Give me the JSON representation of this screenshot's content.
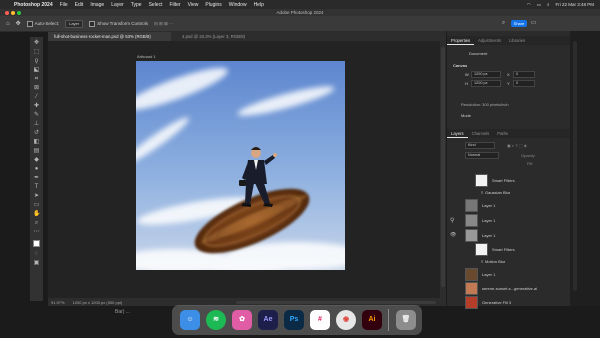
{
  "menubar": {
    "apple": "",
    "items": [
      "Photoshop 2024",
      "File",
      "Edit",
      "Image",
      "Layer",
      "Type",
      "Select",
      "Filter",
      "View",
      "Plugins",
      "Window",
      "Help"
    ],
    "clock": "Fri 22 Mar  3:48 PM"
  },
  "window": {
    "title": "Adobe Photoshop 2024"
  },
  "options": {
    "auto_select": "Auto-Select:",
    "layer_value": "Layer",
    "show_transform": "Show Transform Controls",
    "share": "Share"
  },
  "tabs": [
    {
      "label": "full-shot-business-rocket-man.psd @ 53% (RGB/8)",
      "active": true
    },
    {
      "label": "4.psd @ 33.3% (Layer 3, RGB/8)",
      "active": false
    }
  ],
  "artboard": {
    "label": "Artboard 1"
  },
  "status": {
    "zoom": "91.97%",
    "doc": "1200 px x 1200 px (300 ppi)"
  },
  "properties": {
    "tabs": [
      "Properties",
      "Adjustments",
      "Libraries"
    ],
    "document": "Document",
    "canvas": "Canvas",
    "w_label": "W",
    "w_value": "1200 px",
    "h_label": "H",
    "h_value": "1200 px",
    "x_label": "X",
    "x_value": "0",
    "y_label": "Y",
    "y_value": "0",
    "resolution": "Resolution: 300 pixels/inch",
    "mode": "Mode"
  },
  "layers": {
    "tabs": [
      "Layers",
      "Channels",
      "Paths"
    ],
    "kind": "Kind",
    "mode": "Normal",
    "opacity_label": "Opacity:",
    "fill_label": "Fill:",
    "items": [
      {
        "name": "Smart Filters",
        "thumb": "#f2f2f2"
      },
      {
        "name": "Gaussian Blur",
        "thumb": ""
      },
      {
        "name": "Layer 1",
        "thumb": "#777777"
      },
      {
        "name": "Layer 1",
        "thumb": "#888888"
      },
      {
        "name": "Layer 1",
        "thumb": "#999999"
      },
      {
        "name": "Smart Filters",
        "thumb": "#f2f2f2"
      },
      {
        "name": "Motion Blur",
        "thumb": ""
      },
      {
        "name": "Layer 1",
        "thumb": "#6a4a2f"
      },
      {
        "name": "serene-sunset-s...generative-ai",
        "thumb": "#c27a55"
      },
      {
        "name": "Generative Fill 3",
        "thumb": "#b43e2a"
      }
    ]
  },
  "background_text": "Bar) ...",
  "dock": [
    {
      "name": "Finder",
      "label": "",
      "color": "#3d8ee6"
    },
    {
      "name": "Spotify",
      "label": "",
      "color": "#1db954"
    },
    {
      "name": "Photos",
      "label": "",
      "color": "#e05da6"
    },
    {
      "name": "After Effects",
      "label": "Ae",
      "color": "#1d1e4a"
    },
    {
      "name": "Photoshop",
      "label": "Ps",
      "color": "#0b2a46"
    },
    {
      "name": "Slack",
      "label": "",
      "color": "#ffffff"
    },
    {
      "name": "Chrome",
      "label": "",
      "color": "#e7e7e7"
    },
    {
      "name": "Illustrator",
      "label": "Ai",
      "color": "#33000d"
    },
    {
      "name": "Trash",
      "label": "",
      "color": "#8d8d8d"
    }
  ]
}
